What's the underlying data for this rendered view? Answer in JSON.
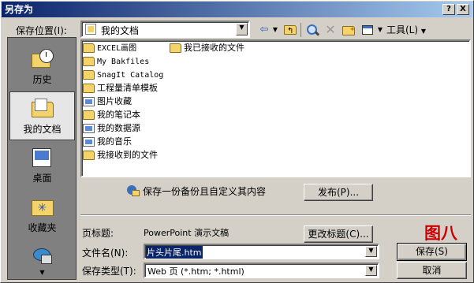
{
  "window": {
    "title": "另存为"
  },
  "titlebar_buttons": {
    "help": "?",
    "close": "X"
  },
  "location": {
    "label": "保存位置(I):",
    "value": "我的文档"
  },
  "toolbar": {
    "tools_label": "工具(L)"
  },
  "places": [
    {
      "label": "历史",
      "icon": "history-icon"
    },
    {
      "label": "我的文档",
      "icon": "my-documents-icon"
    },
    {
      "label": "桌面",
      "icon": "desktop-icon"
    },
    {
      "label": "收藏夹",
      "icon": "favorites-icon"
    },
    {
      "label": "",
      "icon": "network-places-icon"
    }
  ],
  "files_col1": [
    "EXCEL画图",
    "My Bakfiles",
    "SnagIt Catalog",
    "工程量清单模板",
    "图片收藏",
    "我的笔记本",
    "我的数据源",
    "我的音乐",
    "我接收到的文件"
  ],
  "files_col2": [
    "我已接收的文件"
  ],
  "publish": {
    "text": "保存一份备份且自定义其内容",
    "button": "发布(P)..."
  },
  "page_title": {
    "label": "页标题:",
    "value": "PowerPoint 演示文稿",
    "button": "更改标题(C)..."
  },
  "filename": {
    "label": "文件名(N):",
    "value": "片头片尾.htm"
  },
  "filetype": {
    "label": "保存类型(T):",
    "value": "Web 页 (*.htm; *.html)"
  },
  "buttons": {
    "save": "保存(S)",
    "cancel": "取消"
  },
  "annotation": {
    "text": "图八",
    "color": "#cc0000"
  }
}
